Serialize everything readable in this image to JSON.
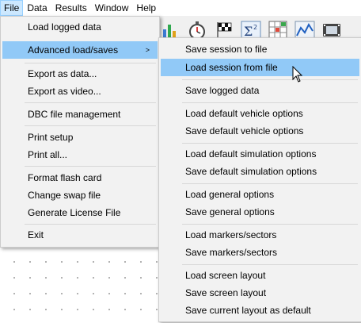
{
  "menubar": {
    "items": [
      "File",
      "Data",
      "Results",
      "Window",
      "Help"
    ]
  },
  "toolbar": {
    "icons": [
      "bar-chart-icon",
      "stopwatch-icon",
      "checkered-flag-icon",
      "sigma-squared-icon",
      "spreadsheet-grid-icon",
      "line-graph-icon",
      "film-icon"
    ]
  },
  "file_menu": {
    "items": [
      {
        "label": "Load logged data"
      },
      {
        "label": "Advanced load/saves",
        "submenu": true,
        "arrow": ">"
      },
      {
        "label": "Export as data..."
      },
      {
        "label": "Export as video..."
      },
      {
        "label": "DBC file management"
      },
      {
        "label": "Print setup"
      },
      {
        "label": "Print all..."
      },
      {
        "label": "Format flash card"
      },
      {
        "label": "Change swap file"
      },
      {
        "label": "Generate License File"
      },
      {
        "label": "Exit"
      }
    ]
  },
  "submenu": {
    "items": [
      {
        "label": "Save session to file"
      },
      {
        "label": "Load session from file"
      },
      {
        "label": "Save logged data"
      },
      {
        "label": "Load default vehicle options"
      },
      {
        "label": "Save default vehicle options"
      },
      {
        "label": "Load default simulation options"
      },
      {
        "label": "Save default simulation options"
      },
      {
        "label": "Load general options"
      },
      {
        "label": "Save general options"
      },
      {
        "label": "Load markers/sectors"
      },
      {
        "label": "Save markers/sectors"
      },
      {
        "label": "Load screen layout"
      },
      {
        "label": "Save screen layout"
      },
      {
        "label": "Save current layout as default"
      }
    ]
  },
  "colors": {
    "menu_bg": "#f2f2f2",
    "highlight": "#91c9f7",
    "menubar_active": "#cce8ff"
  }
}
